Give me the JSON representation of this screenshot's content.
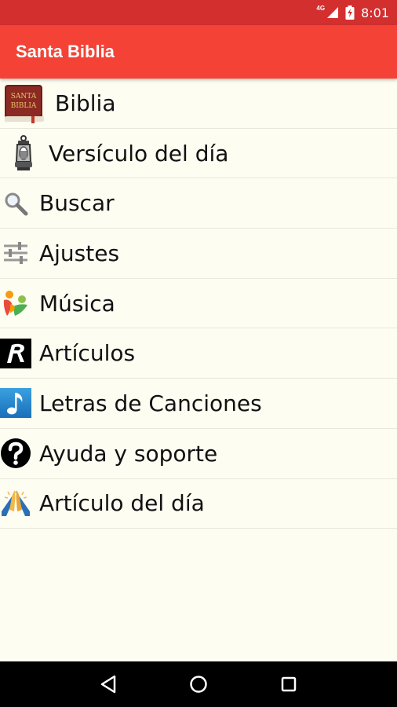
{
  "status_bar": {
    "network": "4G",
    "time": "8:01"
  },
  "app_bar": {
    "title": "Santa Biblia"
  },
  "menu": [
    {
      "label": "Biblia",
      "icon": "bible-book-icon"
    },
    {
      "label": "Versículo del día",
      "icon": "lantern-icon"
    },
    {
      "label": "Buscar",
      "icon": "magnifier-icon"
    },
    {
      "label": "Ajustes",
      "icon": "sliders-icon"
    },
    {
      "label": "Música",
      "icon": "music-people-icon"
    },
    {
      "label": "Artículos",
      "icon": "r-logo-icon"
    },
    {
      "label": "Letras de Canciones",
      "icon": "music-note-icon"
    },
    {
      "label": "Ayuda y soporte",
      "icon": "question-mark-icon"
    },
    {
      "label": "Artículo del día",
      "icon": "praying-hands-icon"
    }
  ],
  "bible_icon_text": [
    "SANTA",
    "BIBLIA"
  ],
  "colors": {
    "status_bar": "#d32f2f",
    "app_bar": "#f44336",
    "background": "#fdfdf2",
    "nav_bar": "#000000"
  },
  "nav_bar": {
    "back": "back-icon",
    "home": "home-icon",
    "recents": "recents-icon"
  }
}
